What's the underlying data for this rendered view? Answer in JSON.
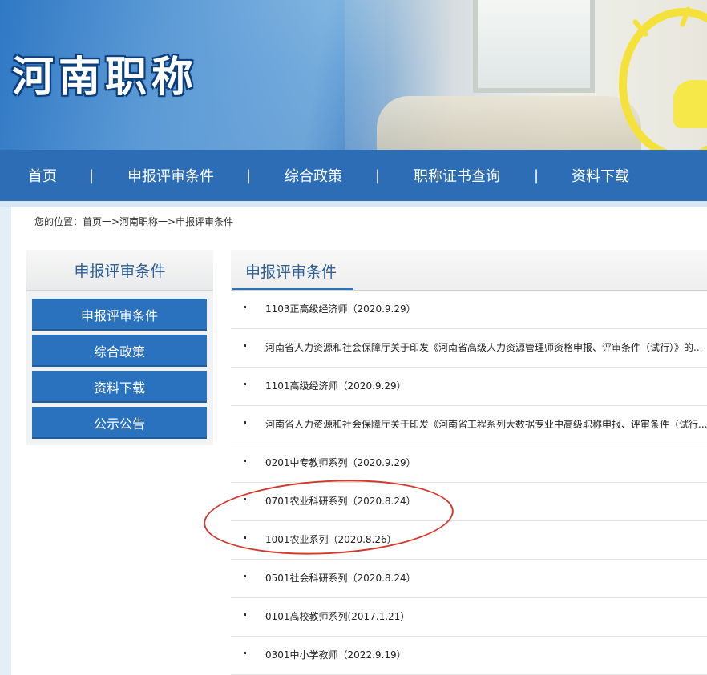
{
  "banner": {
    "title": "河南职称"
  },
  "nav": {
    "items": [
      "首页",
      "申报评审条件",
      "综合政策",
      "职称证书查询",
      "资料下载"
    ],
    "separator": "|"
  },
  "breadcrumb": "您的位置：首页一>河南职称一>申报评审条件",
  "sidebar": {
    "title": "申报评审条件",
    "items": [
      "申报评审条件",
      "综合政策",
      "资料下载",
      "公示公告"
    ]
  },
  "content": {
    "title": "申报评审条件",
    "items": [
      "1103正高级经济师（2020.9.29）",
      "河南省人力资源和社会保障厅关于印发《河南省高级人力资源管理师资格申报、评审条件（试行）》的...",
      "1101高级经济师（2020.9.29）",
      "河南省人力资源和社会保障厅关于印发《河南省工程系列大数据专业中高级职称申报、评审条件（试行...",
      "0201中专教师系列（2020.9.29）",
      "0701农业科研系列（2020.8.24）",
      "1001农业系列（2020.8.26）",
      "0501社会科研系列（2020.8.24）",
      "0101高校教师系列(2017.1.21）",
      "0301中小学教师（2022.9.19）"
    ]
  },
  "colors": {
    "nav_bg": "#2d6db5",
    "button_bg": "#2b72be",
    "title_text": "#2c5f96",
    "annotation": "#d23a2e"
  }
}
